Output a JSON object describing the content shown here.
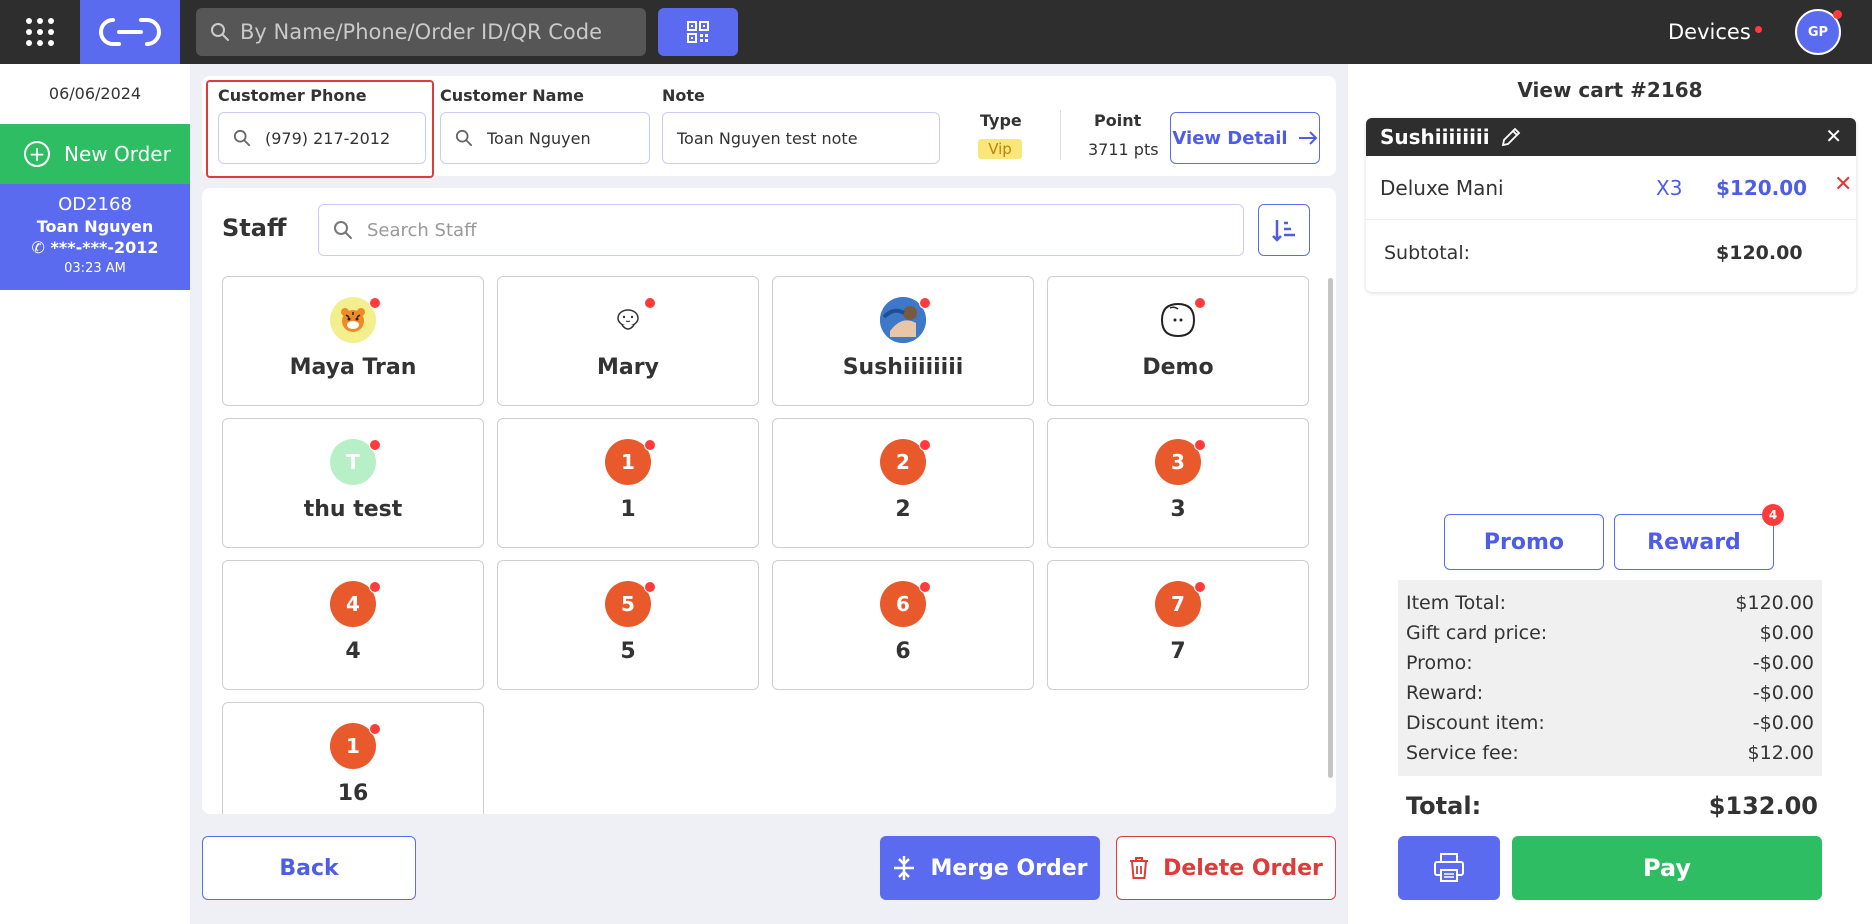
{
  "topbar": {
    "search_placeholder": "By Name/Phone/Order ID/QR Code",
    "devices_label": "Devices",
    "user_initials": "GP"
  },
  "sidebar": {
    "date": "06/06/2024",
    "new_order_label": "New Order",
    "order": {
      "id": "OD2168",
      "customer_name": "Toan Nguyen",
      "phone_masked": "***-***-2012",
      "time": "03:23 AM"
    }
  },
  "customer": {
    "phone_label": "Customer Phone",
    "phone_value": "(979) 217-2012",
    "name_label": "Customer Name",
    "name_value": "Toan Nguyen",
    "note_label": "Note",
    "note_value": "Toan Nguyen test note",
    "type_label": "Type",
    "type_value": "Vip",
    "point_label": "Point",
    "point_value": "3711 pts",
    "view_detail_label": "View Detail"
  },
  "staff": {
    "title": "Staff",
    "search_placeholder": "Search Staff",
    "members": [
      {
        "name": "Maya Tran",
        "avatar_text": "",
        "avatar_style": "yellow",
        "icon": "tiger-avatar-icon"
      },
      {
        "name": "Mary",
        "avatar_text": "",
        "avatar_style": "white",
        "icon": "cartoon-avatar-icon"
      },
      {
        "name": "Sushiiiiiiii",
        "avatar_text": "",
        "avatar_style": "blue",
        "icon": "photo-avatar-icon"
      },
      {
        "name": "Demo",
        "avatar_text": "",
        "avatar_style": "white",
        "icon": "face-sketch-avatar-icon"
      },
      {
        "name": "thu test",
        "avatar_text": "T",
        "avatar_style": "mint"
      },
      {
        "name": "1",
        "avatar_text": "1",
        "avatar_style": "orange"
      },
      {
        "name": "2",
        "avatar_text": "2",
        "avatar_style": "orange"
      },
      {
        "name": "3",
        "avatar_text": "3",
        "avatar_style": "orange"
      },
      {
        "name": "4",
        "avatar_text": "4",
        "avatar_style": "orange"
      },
      {
        "name": "5",
        "avatar_text": "5",
        "avatar_style": "orange"
      },
      {
        "name": "6",
        "avatar_text": "6",
        "avatar_style": "orange"
      },
      {
        "name": "7",
        "avatar_text": "7",
        "avatar_style": "orange"
      },
      {
        "name": "16",
        "avatar_text": "1",
        "avatar_style": "orange"
      }
    ]
  },
  "actions": {
    "back_label": "Back",
    "merge_label": "Merge Order",
    "delete_label": "Delete Order"
  },
  "cart": {
    "title": "View cart #2168",
    "staff_name": "Sushiiiiiiii",
    "items": [
      {
        "name": "Deluxe Mani",
        "qty": "X3",
        "price": "$120.00"
      }
    ],
    "subtotal_label": "Subtotal:",
    "subtotal_value": "$120.00",
    "promo_label": "Promo",
    "reward_label": "Reward",
    "reward_badge": "4",
    "summary": [
      {
        "label": "Item Total:",
        "value": "$120.00"
      },
      {
        "label": "Gift card price:",
        "value": "$0.00"
      },
      {
        "label": "Promo:",
        "value": "-$0.00"
      },
      {
        "label": "Reward:",
        "value": "-$0.00"
      },
      {
        "label": "Discount item:",
        "value": "-$0.00"
      },
      {
        "label": "Service fee:",
        "value": "$12.00"
      }
    ],
    "total_label": "Total:",
    "total_value": "$132.00",
    "pay_label": "Pay"
  },
  "colors": {
    "accent": "#5b6bf0",
    "success": "#2fbd63",
    "danger": "#e03a3a",
    "staff_avatar": "#e85a2b",
    "topbar": "#2e2e2e"
  }
}
